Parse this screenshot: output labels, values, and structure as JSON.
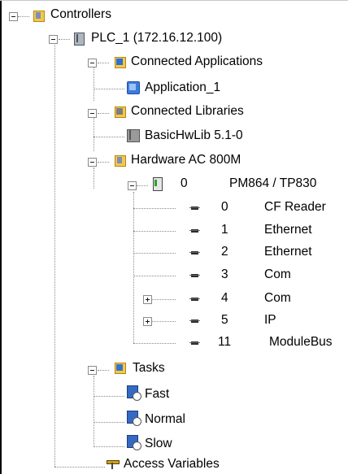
{
  "tree": {
    "controllers": "Controllers",
    "plc": "PLC_1 (172.16.12.100)",
    "connected_applications": "Connected Applications",
    "application": "Application_1",
    "connected_libraries": "Connected Libraries",
    "library": "BasicHwLib 5.1-0",
    "hardware": "Hardware  AC 800M",
    "cpu": {
      "num": "0",
      "name": "PM864 / TP830"
    },
    "modules": [
      {
        "num": "0",
        "name": "CF Reader"
      },
      {
        "num": "1",
        "name": "Ethernet"
      },
      {
        "num": "2",
        "name": "Ethernet"
      },
      {
        "num": "3",
        "name": "Com"
      },
      {
        "num": "4",
        "name": "Com"
      },
      {
        "num": "5",
        "name": "IP"
      },
      {
        "num": "11",
        "name": "ModuleBus"
      }
    ],
    "tasks": "Tasks",
    "task_items": [
      "Fast",
      "Normal",
      "Slow"
    ],
    "access_variables": "Access Variables"
  }
}
